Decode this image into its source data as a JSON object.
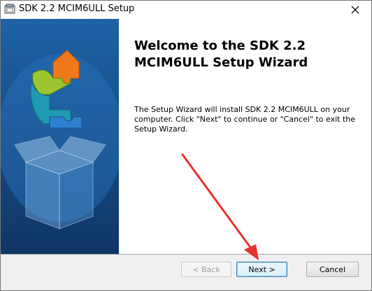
{
  "window": {
    "title": "SDK 2.2 MCIM6ULL Setup",
    "close_label": "✕"
  },
  "content": {
    "title": "Welcome to the SDK 2.2 MCIM6ULL Setup Wizard",
    "body": "The Setup Wizard will install SDK 2.2 MCIM6ULL on your computer.  Click \"Next\" to continue or \"Cancel\" to exit the Setup Wizard."
  },
  "buttons": {
    "back": "< Back",
    "next": "Next >",
    "cancel": "Cancel"
  },
  "colors": {
    "sidebar_top": "#1e63a6",
    "sidebar_bottom": "#0f3565",
    "arrow": "#e4332b"
  }
}
